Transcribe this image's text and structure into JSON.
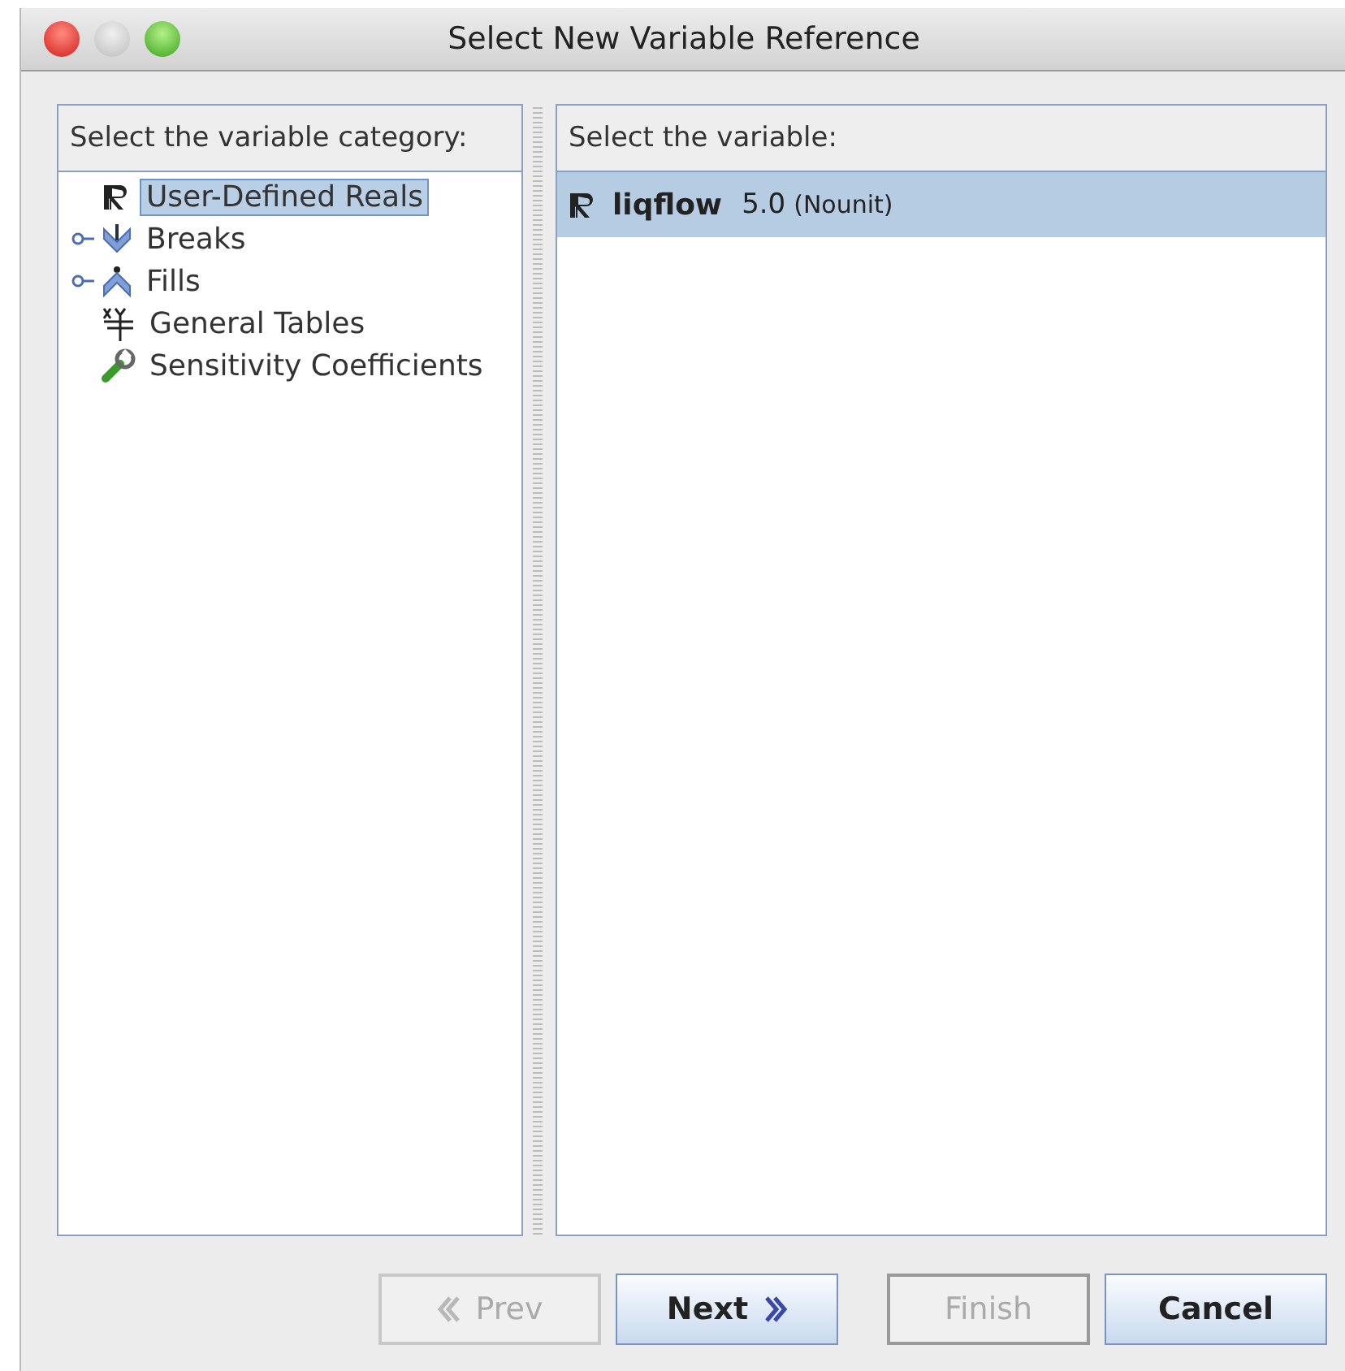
{
  "window": {
    "title": "Select New Variable Reference"
  },
  "categories": {
    "header": "Select the variable category:",
    "items": [
      {
        "label": "User-Defined Reals",
        "kind": "reals",
        "expandable": false,
        "selected": true
      },
      {
        "label": "Breaks",
        "kind": "breaks",
        "expandable": true,
        "selected": false
      },
      {
        "label": "Fills",
        "kind": "fills",
        "expandable": true,
        "selected": false
      },
      {
        "label": "General Tables",
        "kind": "tables",
        "expandable": false,
        "selected": false
      },
      {
        "label": "Sensitivity Coefficients",
        "kind": "sensitivity",
        "expandable": false,
        "selected": false
      }
    ]
  },
  "variables": {
    "header": "Select the variable:",
    "items": [
      {
        "name": "liqflow",
        "value": "5.0",
        "unit": "(Nounit)",
        "selected": true
      }
    ]
  },
  "buttons": [
    {
      "label": "Prev",
      "kind": "prev",
      "disabled": true
    },
    {
      "label": "Next",
      "kind": "next",
      "disabled": false
    },
    {
      "label": "Finish",
      "kind": "plain",
      "disabled": true
    },
    {
      "label": "Cancel",
      "kind": "plain",
      "disabled": false
    }
  ]
}
